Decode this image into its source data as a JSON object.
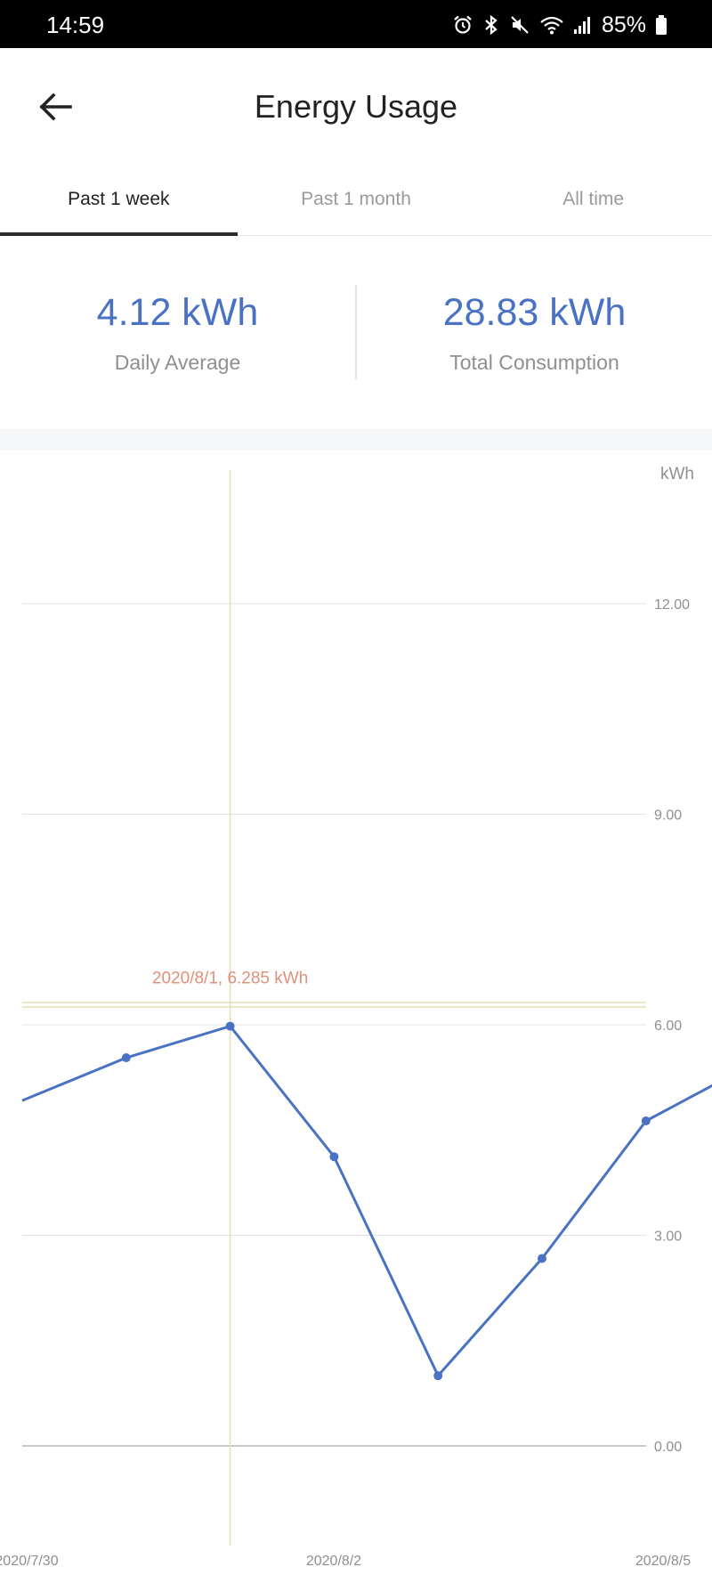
{
  "status_bar": {
    "time": "14:59",
    "battery": "85%",
    "icons": [
      "alarm-icon",
      "bluetooth-icon",
      "mute-icon",
      "wifi-icon",
      "signal-icon",
      "battery-icon"
    ]
  },
  "header": {
    "title": "Energy Usage",
    "back_icon": "arrow-left-icon"
  },
  "tabs": [
    {
      "label": "Past 1 week",
      "active": true
    },
    {
      "label": "Past 1 month",
      "active": false
    },
    {
      "label": "All time",
      "active": false
    }
  ],
  "summary": {
    "daily_average": {
      "value": "4.12 kWh",
      "label": "Daily Average"
    },
    "total_consumption": {
      "value": "28.83 kWh",
      "label": "Total Consumption"
    }
  },
  "colors": {
    "accent": "#4a72c4",
    "highlight_line": "#e9dfb3",
    "highlight_label": "#e0907a",
    "grid": "#e3e3e3",
    "axis_text": "#8f8f8f"
  },
  "chart_data": {
    "type": "line",
    "unit_label": "kWh",
    "x_tick_labels": [
      "2020/7/30",
      "2020/8/2",
      "2020/8/5"
    ],
    "y_ticks": [
      "12.00",
      "9.00",
      "6.00",
      "3.00",
      "0.00"
    ],
    "ylim": [
      0,
      12
    ],
    "series": [
      {
        "values": [
          4.92,
          5.53,
          5.98,
          4.12,
          1.0,
          2.67,
          4.63,
          5.42
        ]
      }
    ],
    "highlight": {
      "index": 2,
      "label": "2020/8/1, 6.285 kWh",
      "value": 6.285
    },
    "grid": true
  }
}
